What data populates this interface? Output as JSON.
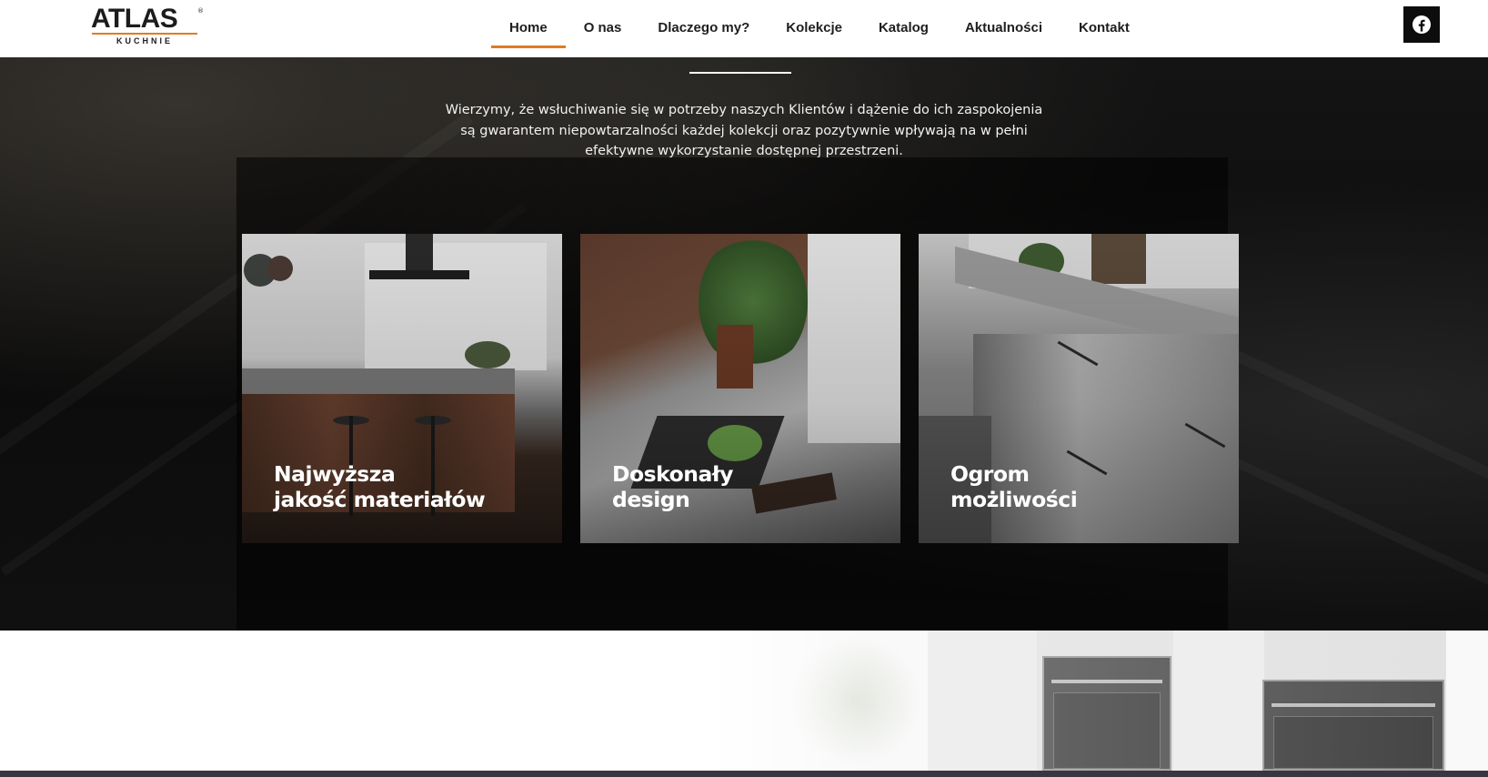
{
  "brand": {
    "name": "ATLAS",
    "registered_mark": "®",
    "tagline": "KUCHNIE",
    "accent_color": "#e07b22"
  },
  "nav": {
    "items": [
      {
        "label": "Home",
        "active": true
      },
      {
        "label": "O nas",
        "active": false
      },
      {
        "label": "Dlaczego my?",
        "active": false
      },
      {
        "label": "Kolekcje",
        "active": false
      },
      {
        "label": "Katalog",
        "active": false
      },
      {
        "label": "Aktualności",
        "active": false
      },
      {
        "label": "Kontakt",
        "active": false
      }
    ]
  },
  "social": {
    "facebook_icon": "facebook-icon"
  },
  "hero": {
    "intro": "Wierzymy, że wsłuchiwanie się w potrzeby naszych Klientów i dążenie do ich zaspokojenia są gwarantem niepowtarzalności każdej kolekcji oraz pozytywnie wpływają na w pełni efektywne wykorzystanie dostępnej przestrzeni."
  },
  "cards": [
    {
      "title_line1": "Najwyższa",
      "title_line2": "jakość materiałów"
    },
    {
      "title_line1": "Doskonały",
      "title_line2": "design"
    },
    {
      "title_line1": "Ogrom",
      "title_line2": "możliwości"
    }
  ]
}
